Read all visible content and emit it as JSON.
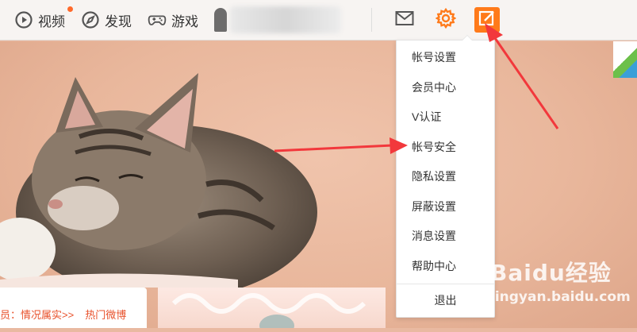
{
  "nav": {
    "items": [
      {
        "label": "视频",
        "icon": "video-play-icon",
        "has_dot": true
      },
      {
        "label": "发现",
        "icon": "compass-icon"
      },
      {
        "label": "游戏",
        "icon": "gamepad-icon"
      }
    ],
    "accent": "#ff7a1a"
  },
  "dropdown": {
    "items": [
      "帐号设置",
      "会员中心",
      "V认证",
      "帐号安全",
      "隐私设置",
      "屏蔽设置",
      "消息设置",
      "帮助中心"
    ],
    "logout": "退出"
  },
  "news": {
    "items": [
      "员：情况属实>>",
      "热门微博"
    ]
  },
  "watermark": {
    "logo": "Baidu经验",
    "url": "jingyan.baidu.com"
  },
  "colors": {
    "annotation_arrow": "#f2383c",
    "dropdown_bg": "#ffffff",
    "news_text": "#e8512b"
  }
}
